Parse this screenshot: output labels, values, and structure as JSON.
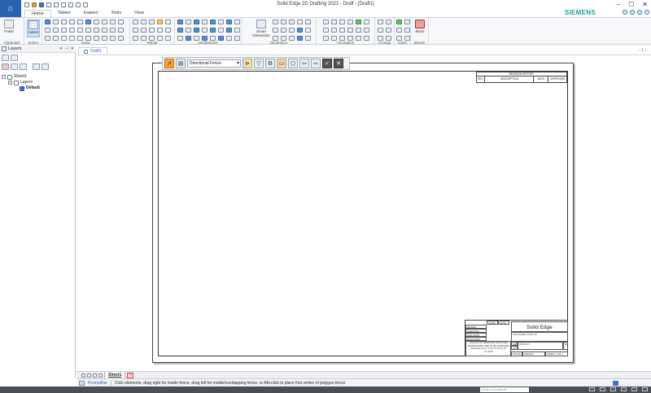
{
  "window": {
    "title": "Solid Edge 2D Drafting 2021 - Draft - [Draft1]",
    "minimize": "–",
    "maximize": "☐",
    "close": "✕"
  },
  "brand": "SIEMENS",
  "ribbon_tabs": [
    "Home",
    "Tables",
    "Inspect",
    "Tools",
    "View"
  ],
  "ribbon_groups": {
    "clipboard": {
      "label": "Clipboard",
      "paste": "Paste"
    },
    "select": {
      "label": "Select",
      "select": "Select"
    },
    "draw": {
      "label": "Draw"
    },
    "relate": {
      "label": "Relate"
    },
    "intellisketch": {
      "label": "IntelliSketch"
    },
    "dimension": {
      "label": "Dimension",
      "smart": "Smart Dimension"
    },
    "annotation": {
      "label": "Annotation"
    },
    "arrange": {
      "label": "Arrange"
    },
    "insert": {
      "label": "Insert"
    },
    "blocks": {
      "label": "Blocks",
      "block": "Block"
    }
  },
  "panel": {
    "title": "Layers",
    "tree": {
      "sheet": "Sheet1",
      "layers": "Layers",
      "default": "Default"
    }
  },
  "document": {
    "tab": "Draft1",
    "controls": "‹ 1 ›"
  },
  "command_bar": {
    "fence_mode": "Directional Fence"
  },
  "revision_table": {
    "title": "REVISION HISTORY",
    "columns": [
      "REV",
      "DESCRIPTION",
      "DATE",
      "APPROVED"
    ]
  },
  "title_block": {
    "logo": "Solid Edge",
    "rows": [
      "NAME",
      "DATE",
      "DRAWN",
      "CHECKED",
      "ENG APPR",
      "MGR APPR"
    ],
    "notes": "UNLESS OTHERWISE SPECIFIED DIMENSIONS ARE IN MILLIMETERS ANGLES ±X.X° 2 PL ±X.XX 3 PL ±X.XXX",
    "size_label": "SIZE",
    "size": "A3",
    "dwg_label": "DWG NO",
    "rev_label": "REV",
    "file_label": "FILE NAME: Draft1.dft",
    "scale_label": "SCALE",
    "weight_label": "WEIGHT",
    "sheet_label": "SHEET 1 OF 1"
  },
  "sheet_tabs": {
    "active": "Sheet1"
  },
  "prompt": {
    "label": "PromptBar",
    "text": "Click elements, drag right for inside fence, drag left for inside/overlapping fence, or Alt+click to place first vertex of polygon fence."
  },
  "status": {
    "find_placeholder": "Find a command"
  }
}
